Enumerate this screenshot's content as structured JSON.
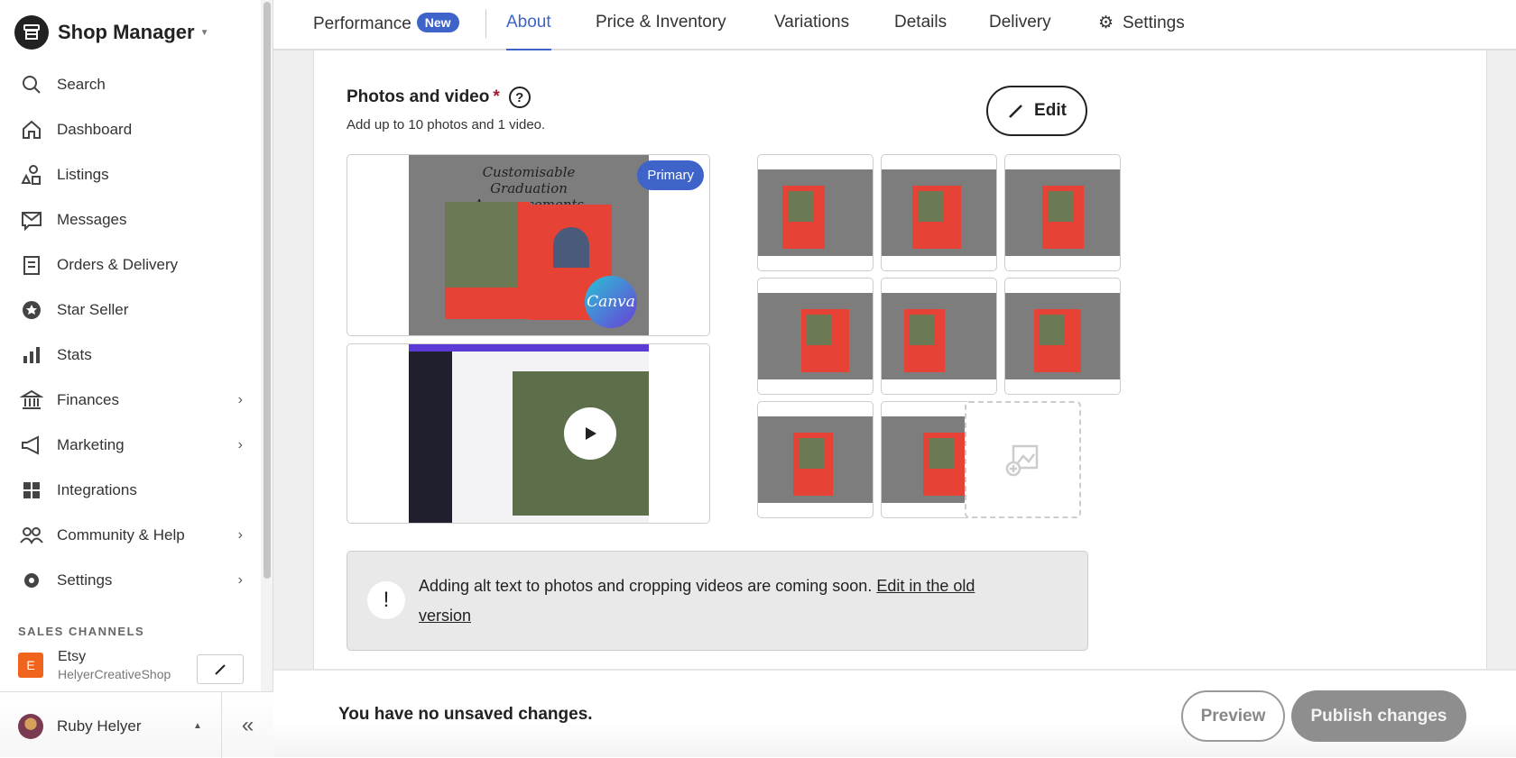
{
  "sidebar": {
    "title": "Shop Manager",
    "items": [
      {
        "label": "Search",
        "icon": "search-icon"
      },
      {
        "label": "Dashboard",
        "icon": "home-icon"
      },
      {
        "label": "Listings",
        "icon": "shapes-icon"
      },
      {
        "label": "Messages",
        "icon": "envelope-icon"
      },
      {
        "label": "Orders & Delivery",
        "icon": "clipboard-icon"
      },
      {
        "label": "Star Seller",
        "icon": "badge-icon"
      },
      {
        "label": "Stats",
        "icon": "bar-chart-icon"
      },
      {
        "label": "Finances",
        "icon": "bank-icon",
        "has_submenu": true
      },
      {
        "label": "Marketing",
        "icon": "megaphone-icon",
        "has_submenu": true
      },
      {
        "label": "Integrations",
        "icon": "grid-icon"
      },
      {
        "label": "Community & Help",
        "icon": "people-icon",
        "has_submenu": true
      },
      {
        "label": "Settings",
        "icon": "gear-icon",
        "has_submenu": true
      }
    ],
    "sales_channels_label": "SALES CHANNELS",
    "channel": {
      "initial": "E",
      "name": "Etsy",
      "shop": "HelyerCreativeShop"
    },
    "user": {
      "name": "Ruby Helyer"
    }
  },
  "tabs": {
    "performance": "Performance",
    "new_badge": "New",
    "about": "About",
    "price_inventory": "Price & Inventory",
    "variations": "Variations",
    "details": "Details",
    "delivery": "Delivery",
    "settings": "Settings",
    "active": "About"
  },
  "photos": {
    "title": "Photos and video",
    "required_mark": "*",
    "help": "?",
    "subtitle": "Add up to 10 photos and 1 video.",
    "edit_label": "Edit",
    "primary_badge": "Primary",
    "primary_image_text": "Customisable Graduation Announcements",
    "canva_label": "Canva"
  },
  "notice": {
    "icon": "!",
    "text": "Adding alt text to photos and cropping videos are coming soon. ",
    "link": "Edit in the old version"
  },
  "footer": {
    "status": "You have no unsaved changes.",
    "preview": "Preview",
    "publish": "Publish changes"
  },
  "colors": {
    "accent": "#3e63c9",
    "etsy": "#f1641e",
    "required": "#a61a2e"
  }
}
